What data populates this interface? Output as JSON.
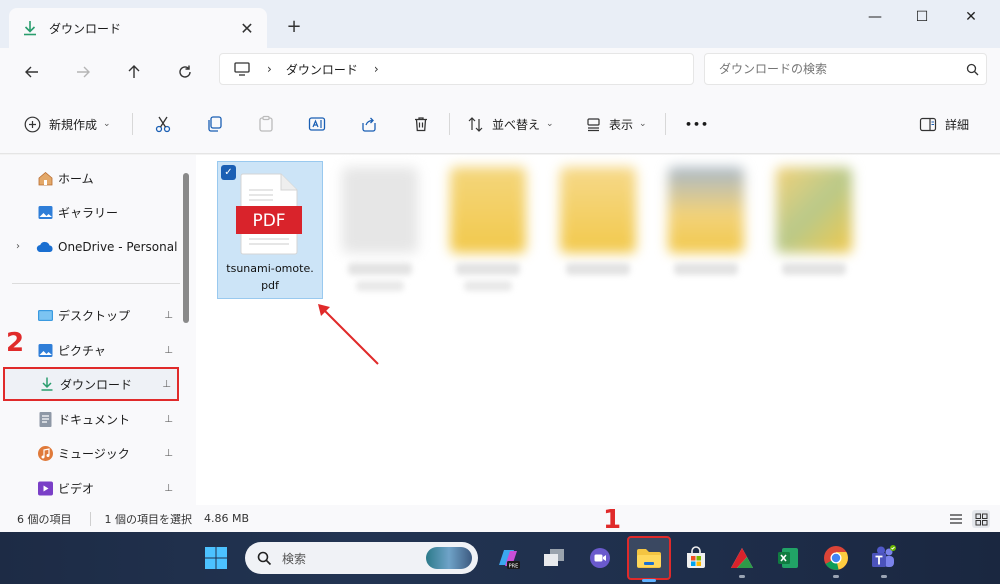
{
  "window": {
    "tab_title": "ダウンロード",
    "new_tab": "+",
    "close_tab": "✕",
    "controls": {
      "minimize": "—",
      "maximize": "☐",
      "close": "✕"
    }
  },
  "address": {
    "breadcrumb_sep": "›",
    "crumb": "ダウンロード",
    "crumb_trail_sep": "›",
    "search_placeholder": "ダウンロードの検索"
  },
  "toolbar": {
    "new_label": "新規作成",
    "sort_label": "並べ替え",
    "view_label": "表示",
    "more_label": "•••",
    "details_label": "詳細"
  },
  "sidebar": {
    "items": [
      {
        "label": "ホーム",
        "icon": "home-icon"
      },
      {
        "label": "ギャラリー",
        "icon": "gallery-icon"
      },
      {
        "label": "OneDrive - Personal",
        "icon": "cloud-icon"
      },
      {
        "label": "デスクトップ",
        "icon": "desktop-icon"
      },
      {
        "label": "ピクチャ",
        "icon": "pictures-icon"
      },
      {
        "label": "ダウンロード",
        "icon": "download-icon",
        "selected": true
      },
      {
        "label": "ドキュメント",
        "icon": "documents-icon"
      },
      {
        "label": "ミュージック",
        "icon": "music-icon"
      },
      {
        "label": "ビデオ",
        "icon": "video-icon"
      }
    ],
    "expand_glyph": "›",
    "pin_glyph": "📌"
  },
  "content": {
    "file": {
      "name": "tsunami-omote.pdf",
      "name_line1": "tsunami-omote.",
      "name_line2": "pdf",
      "badge": "PDF"
    }
  },
  "status": {
    "item_count": "6 個の項目",
    "selection": "1 個の項目を選択",
    "size": "4.86 MB"
  },
  "taskbar": {
    "search_placeholder": "検索"
  },
  "annotations": {
    "step1": "1",
    "step2": "2"
  },
  "colors": {
    "accent": "#1a5fb4",
    "highlight": "#e02a2a",
    "selection": "#cce4f7"
  }
}
